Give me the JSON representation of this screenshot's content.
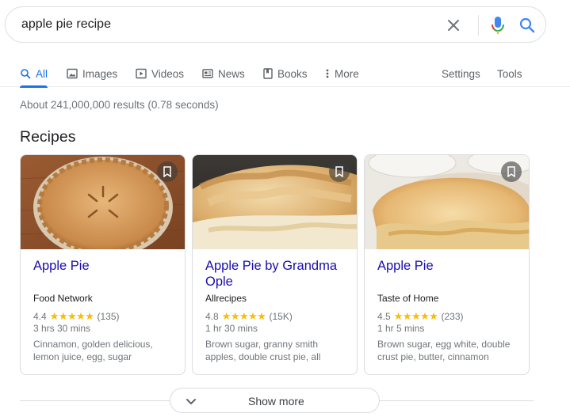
{
  "search": {
    "query": "apple pie recipe"
  },
  "tabs": [
    {
      "label": "All",
      "icon": "search-icon",
      "active": true
    },
    {
      "label": "Images",
      "icon": "image-icon"
    },
    {
      "label": "Videos",
      "icon": "video-icon"
    },
    {
      "label": "News",
      "icon": "news-icon"
    },
    {
      "label": "Books",
      "icon": "book-icon"
    },
    {
      "label": "More",
      "icon": "more-vert-icon"
    }
  ],
  "tools": {
    "settings": "Settings",
    "tools": "Tools"
  },
  "results_stats": "About 241,000,000 results (0.78 seconds)",
  "section_title": "Recipes",
  "cards": [
    {
      "title": "Apple Pie",
      "source": "Food Network",
      "rating": "4.4",
      "stars": "★★★★★",
      "reviews": "(135)",
      "time": "3 hrs 30 mins",
      "ingredients": "Cinnamon, golden delicious, lemon juice, egg, sugar"
    },
    {
      "title": "Apple Pie by Grandma Ople",
      "source": "Allrecipes",
      "rating": "4.8",
      "stars": "★★★★★",
      "reviews": "(15K)",
      "time": "1 hr 30 mins",
      "ingredients": "Brown sugar, granny smith apples, double crust pie, all"
    },
    {
      "title": "Apple Pie",
      "source": "Taste of Home",
      "rating": "4.5",
      "stars": "★★★★★",
      "reviews": "(233)",
      "time": "1 hr 5 mins",
      "ingredients": "Brown sugar, egg white, double crust pie, butter, cinnamon"
    }
  ],
  "show_more": "Show more",
  "colors": {
    "accent": "#1a73e8",
    "link": "#1a0dab",
    "star": "#fbbc04",
    "muted": "#70757a"
  }
}
